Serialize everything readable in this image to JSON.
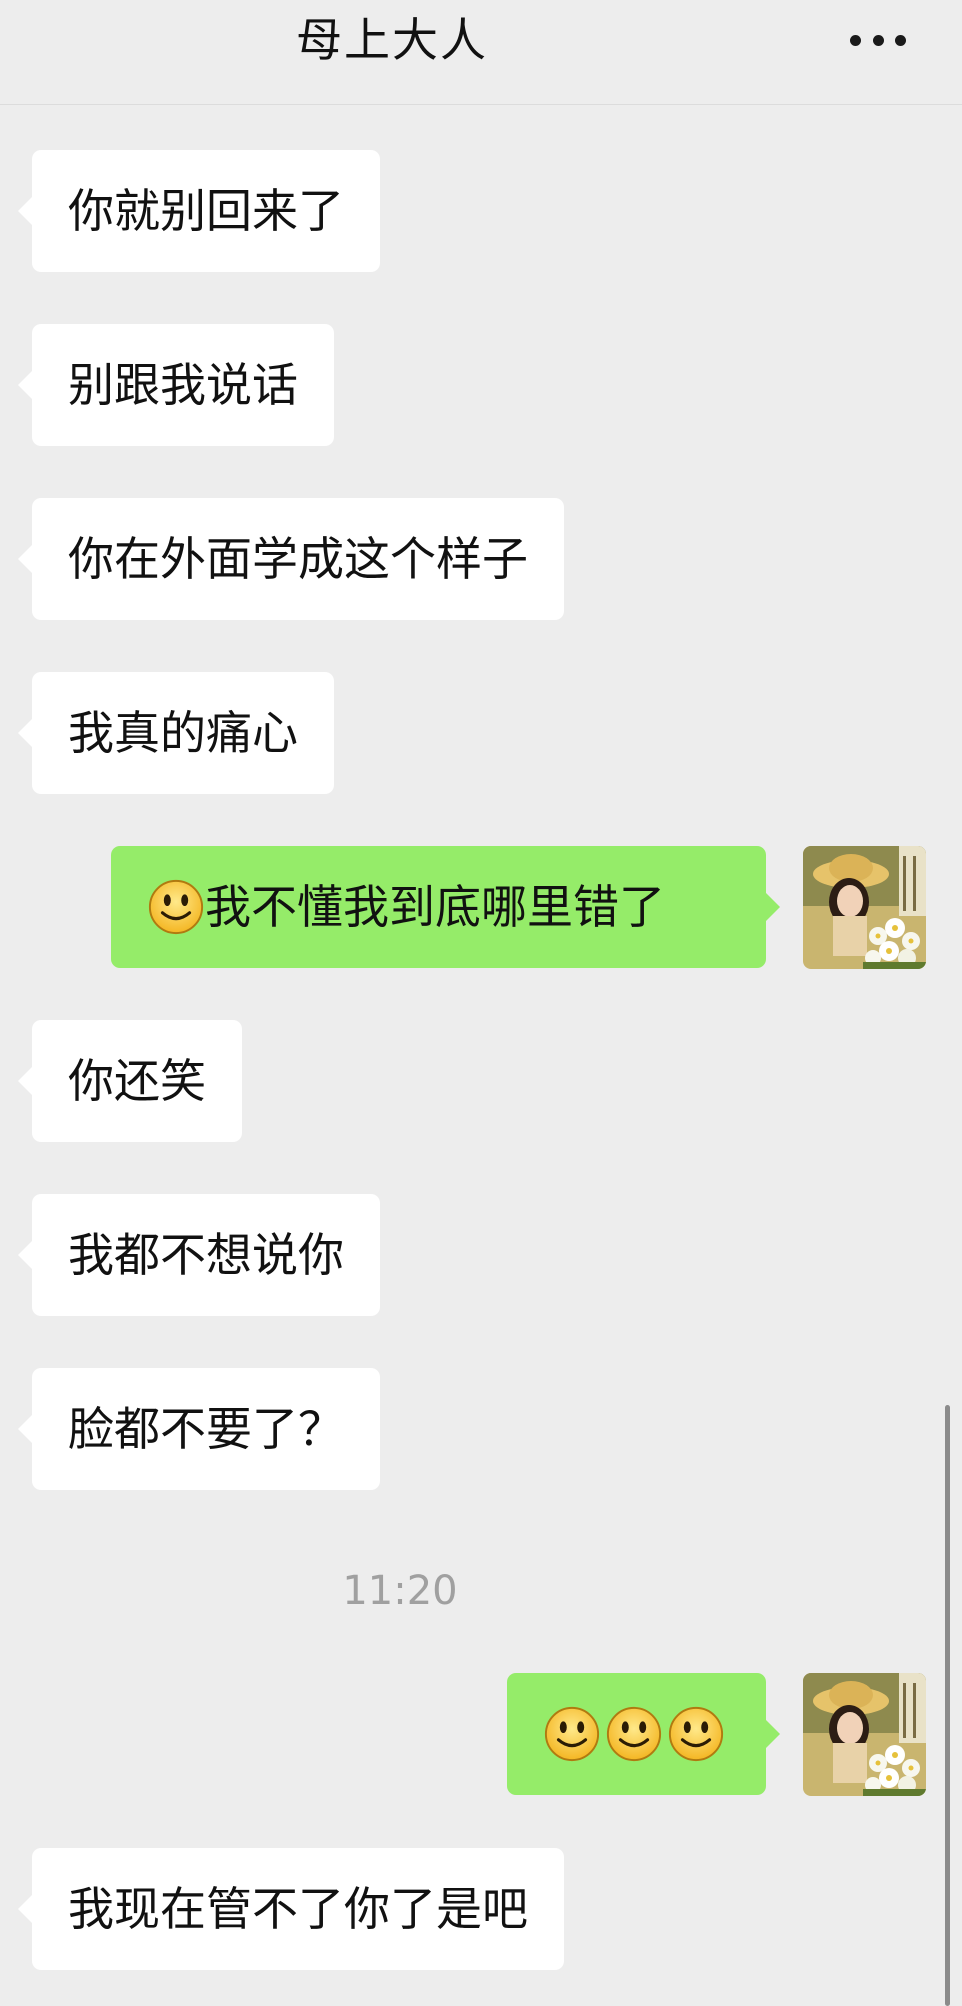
{
  "header": {
    "title": "母上大人",
    "more_icon": "more-dots-icon"
  },
  "messages": [
    {
      "side": "in",
      "text": "你就别回来了"
    },
    {
      "side": "in",
      "text": "别跟我说话"
    },
    {
      "side": "in",
      "text": "你在外面学成这个样子"
    },
    {
      "side": "in",
      "text": "我真的痛心"
    },
    {
      "side": "out",
      "emoji": "smile-emoji",
      "emoji_count": 1,
      "text": "我不懂我到底哪里错了"
    },
    {
      "side": "in",
      "text": "你还笑"
    },
    {
      "side": "in",
      "text": "我都不想说你"
    },
    {
      "side": "in",
      "text": "脸都不要了？"
    },
    {
      "side": "out",
      "emoji": "smile-emoji",
      "emoji_count": 3,
      "text": ""
    },
    {
      "side": "in",
      "text": "我现在管不了你了是吧"
    }
  ],
  "timestamp": "11:20",
  "colors": {
    "background": "#ededed",
    "incoming_bubble": "#ffffff",
    "outgoing_bubble": "#95ec69",
    "timestamp_text": "#a0a0a0"
  }
}
